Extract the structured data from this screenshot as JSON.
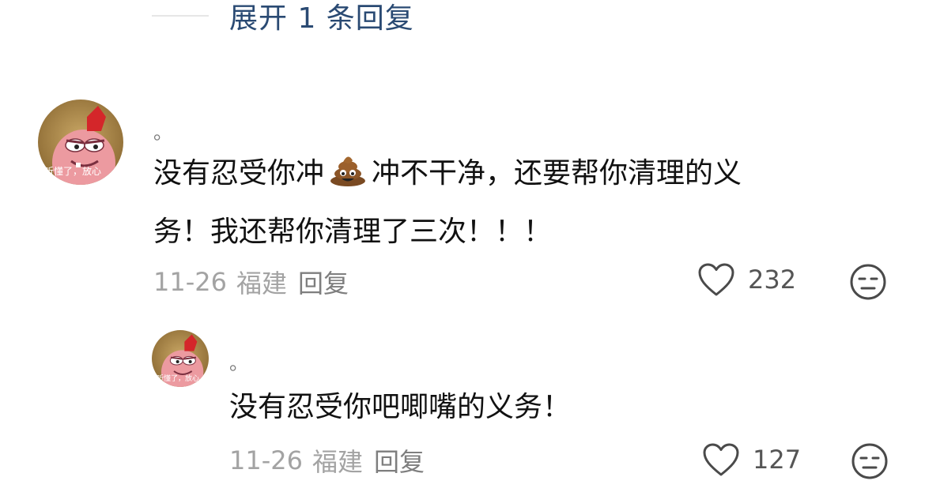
{
  "thread": {
    "expand_label": "展开 1 条回复"
  },
  "comments": [
    {
      "username": "。",
      "avatar_caption": "听懂了，放心",
      "text_line1_a": "没有忍受你冲",
      "emoji": "poop-emoji",
      "text_line1_b": "冲不干净，还要帮你清理的义",
      "text_line2": "务！我还帮你清理了三次！！！",
      "date": "11-26",
      "region": "福建",
      "reply_label": "回复",
      "likes": "232"
    },
    {
      "username": "。",
      "avatar_caption": "听懂了，放心",
      "text": "没有忍受你吧唧嘴的义务！",
      "date": "11-26",
      "region": "福建",
      "reply_label": "回复",
      "likes": "127"
    }
  ],
  "icons": {
    "like": "heart-outline-icon",
    "dislike": "neutral-face-icon"
  },
  "colors": {
    "expand_link": "#2a4a73",
    "meta_text": "#a3a3a3",
    "body_text": "#111111"
  }
}
